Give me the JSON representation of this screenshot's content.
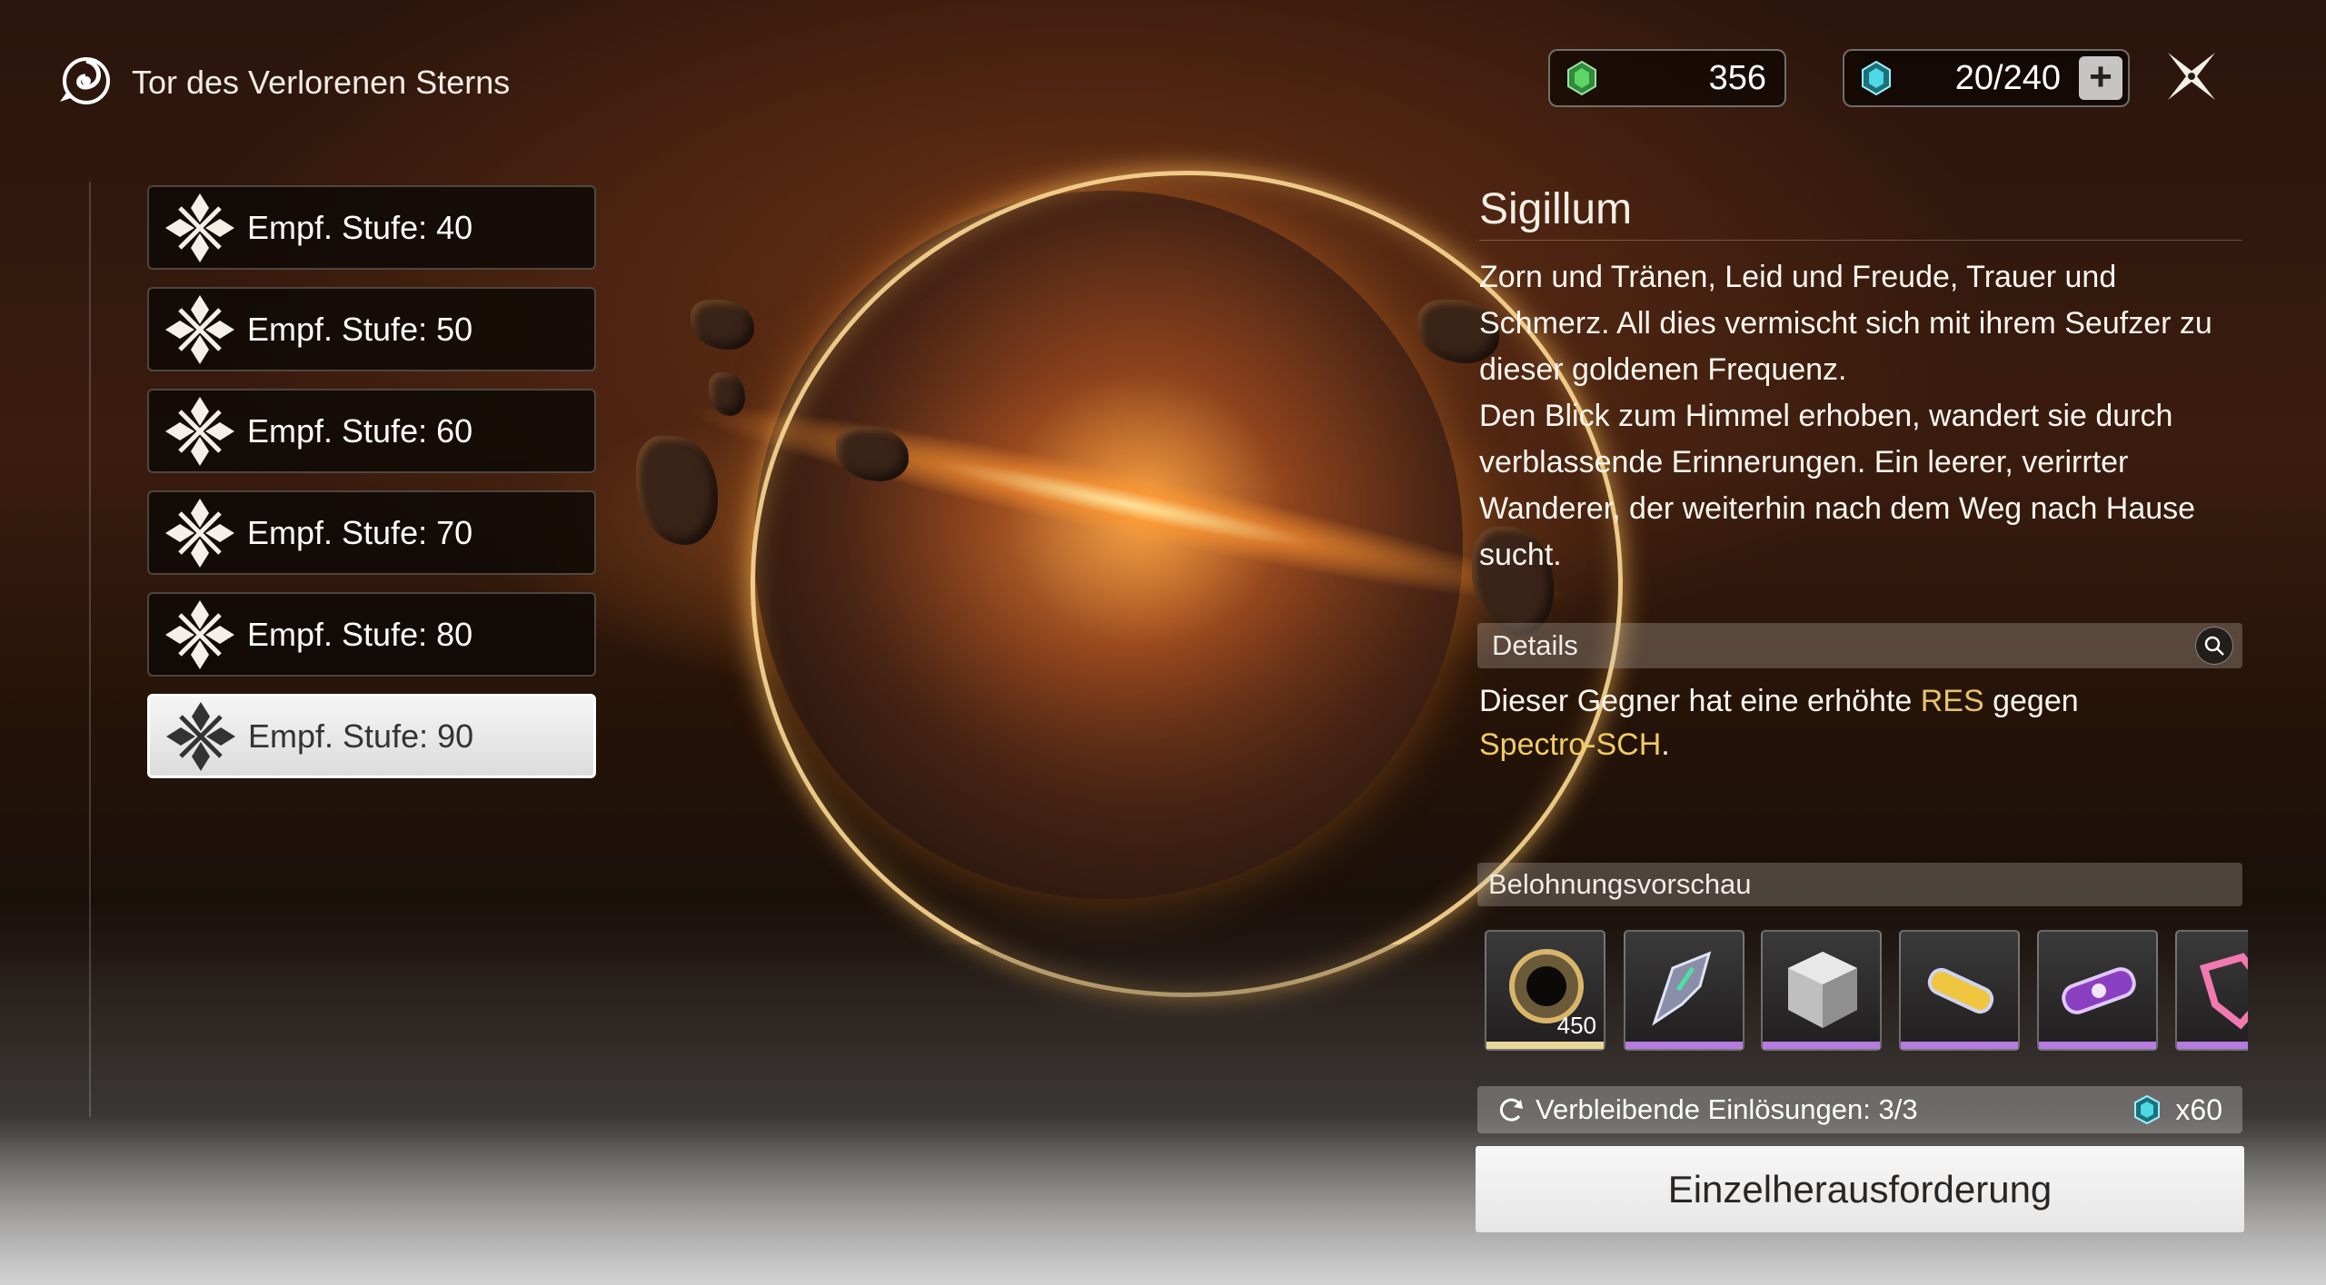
{
  "header": {
    "title": "Tor des Verlorenen Sterns",
    "currency_1": "356",
    "currency_2": "20/240",
    "plus_label": "+"
  },
  "levels": [
    {
      "label": "Empf. Stufe: 40"
    },
    {
      "label": "Empf. Stufe: 50"
    },
    {
      "label": "Empf. Stufe: 60"
    },
    {
      "label": "Empf. Stufe: 70"
    },
    {
      "label": "Empf. Stufe: 80"
    },
    {
      "label": "Empf. Stufe: 90",
      "selected": true
    }
  ],
  "boss": {
    "name": "Sigillum",
    "description_1": "Zorn und Tränen, Leid und Freude, Trauer und Schmerz. All dies vermischt sich mit ihrem Seufzer zu dieser goldenen Frequenz.",
    "description_2": "Den Blick zum Himmel erhoben, wandert sie durch verblassende Erinnerungen. Ein leerer, verirrter Wanderer, der weiterhin nach dem Weg nach Hause sucht."
  },
  "details": {
    "header": "Details",
    "text_1": "Dieser Gegner hat eine erhöhte ",
    "highlight_res": "RES",
    "text_2": " gegen ",
    "highlight_element": "Spectro-SCH",
    "text_3": "."
  },
  "rewards": {
    "header": "Belohnungsvorschau",
    "items": [
      {
        "icon": "shell-credit-icon",
        "count": "450",
        "rarity_color": "#e8d79a"
      },
      {
        "icon": "weapon-material-icon",
        "count": "",
        "rarity_color": "#b57be0"
      },
      {
        "icon": "material-cube-icon",
        "count": "",
        "rarity_color": "#b57be0"
      },
      {
        "icon": "exp-capsule-icon",
        "count": "",
        "rarity_color": "#b57be0"
      },
      {
        "icon": "energy-core-icon",
        "count": "",
        "rarity_color": "#b57be0"
      },
      {
        "icon": "tuner-icon",
        "count": "",
        "rarity_color": "#b57be0"
      }
    ]
  },
  "redeem": {
    "label": "Verbleibende Einlösungen: 3/3",
    "cost": "x60"
  },
  "action": {
    "button_label": "Einzelherausforderung"
  },
  "colors": {
    "accent_gold": "#e7c36b",
    "selected_bg": "#ececec"
  }
}
